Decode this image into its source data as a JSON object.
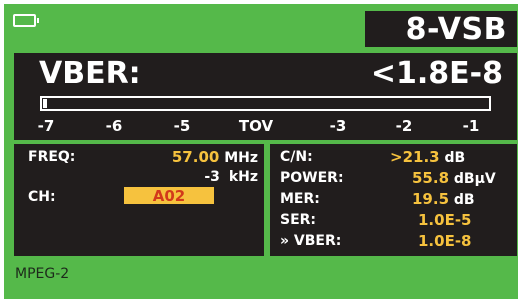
{
  "header": {
    "mode": "8-VSB",
    "battery_icon": "battery-icon"
  },
  "vber": {
    "label": "VBER:",
    "value": "<1.8E-8",
    "bar_fill_fraction": 0.01,
    "scale": [
      "-7",
      "-6",
      "-5",
      "TOV",
      "-3",
      "-2",
      "-1"
    ]
  },
  "left": {
    "freq_label": "FREQ:",
    "freq_value": "57.00",
    "freq_unit": "MHz",
    "offset_value": "-3",
    "offset_unit": "kHz",
    "ch_label": "CH:",
    "ch_value": "A02"
  },
  "right": {
    "cn_label": "C/N:",
    "cn_value": ">21.3",
    "cn_unit": "dB",
    "power_label": "POWER:",
    "power_value": "55.8",
    "power_unit": "dBµV",
    "mer_label": "MER:",
    "mer_value": "19.5",
    "mer_unit": "dB",
    "ser_label": "SER:",
    "ser_value": "1.0E-5",
    "vber_label": "» VBER:",
    "vber_value": "1.0E-8"
  },
  "footer": {
    "stream": "MPEG-2"
  },
  "colors": {
    "frame": "#55b94a",
    "panel": "#211d1d",
    "value": "#f6c23e",
    "channel_text": "#d23a1b"
  }
}
